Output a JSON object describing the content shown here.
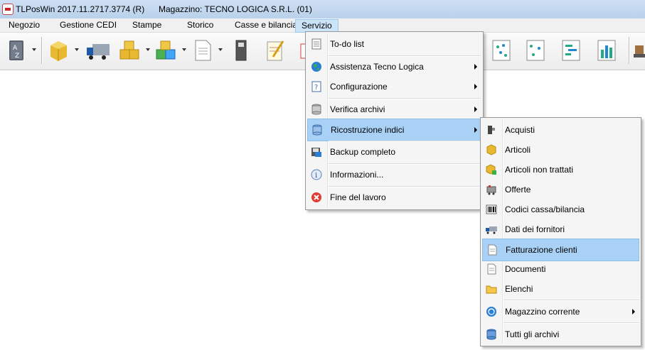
{
  "window": {
    "title": "TLPosWin 2017.11.2717.3774 (R)",
    "store": "Magazzino: TECNO LOGICA S.R.L. (01)"
  },
  "menubar": [
    "Negozio",
    "Gestione CEDI",
    "Stampe",
    "Storico",
    "Casse e bilancia",
    "Servizio"
  ],
  "servizio_menu": [
    {
      "label": "To-do list",
      "icon": "todo-list-icon",
      "submenu": false
    },
    {
      "label": "Assistenza Tecno Logica",
      "icon": "globe-icon",
      "submenu": true
    },
    {
      "label": "Configurazione",
      "icon": "configuration-icon",
      "submenu": true
    },
    {
      "label": "Verifica archivi",
      "icon": "database-check-icon",
      "submenu": true
    },
    {
      "label": "Ricostruzione indici",
      "icon": "database-index-icon",
      "submenu": true,
      "highlighted": true
    },
    {
      "label": "Backup completo",
      "icon": "backup-icon",
      "submenu": false
    },
    {
      "label": "Informazioni...",
      "icon": "info-icon",
      "submenu": false
    },
    {
      "label": "Fine del lavoro",
      "icon": "exit-icon",
      "submenu": false
    }
  ],
  "ricostruzione_menu": [
    {
      "label": "Acquisti",
      "icon": "purchases-icon"
    },
    {
      "label": "Articoli",
      "icon": "articles-icon"
    },
    {
      "label": "Articoli non trattati",
      "icon": "articles-add-icon"
    },
    {
      "label": "Offerte",
      "icon": "offers-icon"
    },
    {
      "label": "Codici cassa/bilancia",
      "icon": "barcode-icon"
    },
    {
      "label": "Dati dei fornitori",
      "icon": "truck-icon"
    },
    {
      "label": "Fatturazione clienti",
      "icon": "invoice-icon",
      "highlighted": true
    },
    {
      "label": "Documenti",
      "icon": "document-icon"
    },
    {
      "label": "Elenchi",
      "icon": "folder-icon"
    },
    {
      "label": "Magazzino corrente",
      "icon": "warehouse-sync-icon",
      "submenu": true
    },
    {
      "label": "Tutti gli archivi",
      "icon": "all-archives-icon"
    }
  ],
  "colors": {
    "highlight": "#a8d1f5",
    "menubar_active": "#cce4f7",
    "titlebar": "#c4d8ef"
  }
}
